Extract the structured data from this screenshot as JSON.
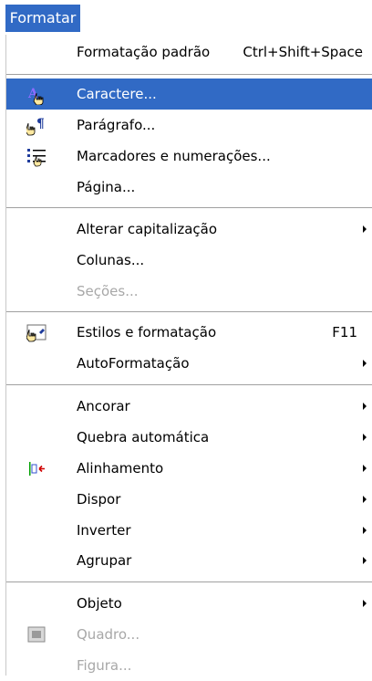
{
  "menu_title": "Formatar",
  "items": {
    "default_formatting": {
      "label": "Formatação padrão",
      "shortcut": "Ctrl+Shift+Space"
    },
    "character": {
      "label": "Caractere..."
    },
    "paragraph": {
      "label": "Parágrafo..."
    },
    "bullets": {
      "label": "Marcadores e numerações..."
    },
    "page": {
      "label": "Página..."
    },
    "change_case": {
      "label": "Alterar capitalização"
    },
    "columns": {
      "label": "Colunas..."
    },
    "sections": {
      "label": "Seções..."
    },
    "styles": {
      "label": "Estilos e formatação",
      "shortcut": "F11"
    },
    "autoformat": {
      "label": "AutoFormatação"
    },
    "anchor": {
      "label": "Ancorar"
    },
    "wrap": {
      "label": "Quebra automática"
    },
    "alignment": {
      "label": "Alinhamento"
    },
    "arrange": {
      "label": "Dispor"
    },
    "flip": {
      "label": "Inverter"
    },
    "group": {
      "label": "Agrupar"
    },
    "object": {
      "label": "Objeto"
    },
    "frame": {
      "label": "Quadro..."
    },
    "picture": {
      "label": "Figura..."
    }
  },
  "colors": {
    "highlight": "#316ac5",
    "disabled_text": "#a8a8a8",
    "separator": "#a0a0a0"
  },
  "icons": {
    "character": "character-pointer-icon",
    "paragraph": "paragraph-pointer-icon",
    "bullets": "bullets-numbering-icon",
    "styles": "styles-formatting-icon",
    "alignment": "alignment-icon",
    "frame": "frame-icon"
  }
}
